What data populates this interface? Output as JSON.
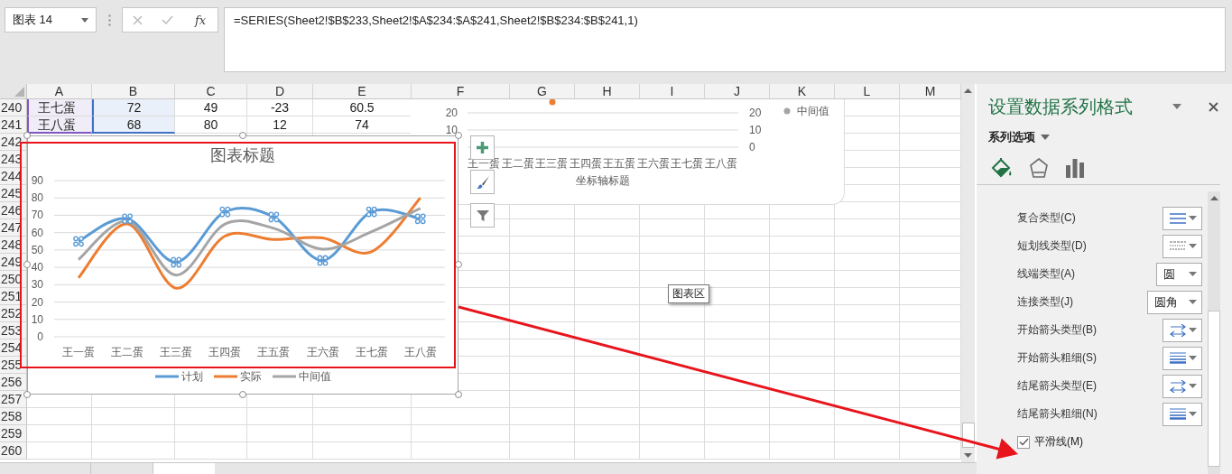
{
  "name_box": {
    "value": "图表 14"
  },
  "formula_bar": {
    "function_label": "fx",
    "formula": "=SERIES(Sheet2!$B$233,Sheet2!$A$234:$A$241,Sheet2!$B$234:$B$241,1)"
  },
  "sheet": {
    "columns": [
      {
        "label": "A",
        "color": "#7e57c2"
      },
      {
        "label": "B",
        "color": "#3f72c6"
      },
      {
        "label": "C"
      },
      {
        "label": "D"
      },
      {
        "label": "E"
      },
      {
        "label": "F"
      },
      {
        "label": "G"
      },
      {
        "label": "H"
      },
      {
        "label": "I"
      },
      {
        "label": "J"
      },
      {
        "label": "K"
      },
      {
        "label": "L"
      },
      {
        "label": "M"
      }
    ],
    "rows": [
      {
        "number": "240",
        "cells": [
          "王七蛋",
          "72",
          "49",
          "-23",
          "60.5"
        ]
      },
      {
        "number": "241",
        "cells": [
          "王八蛋",
          "68",
          "80",
          "12",
          "74"
        ]
      },
      {
        "number": "242"
      },
      {
        "number": "243"
      },
      {
        "number": "244"
      },
      {
        "number": "245"
      },
      {
        "number": "246"
      },
      {
        "number": "247"
      },
      {
        "number": "248"
      },
      {
        "number": "249"
      },
      {
        "number": "250"
      },
      {
        "number": "251"
      },
      {
        "number": "252"
      },
      {
        "number": "253"
      },
      {
        "number": "254"
      },
      {
        "number": "255"
      },
      {
        "number": "256"
      },
      {
        "number": "257"
      },
      {
        "number": "258"
      },
      {
        "number": "259"
      },
      {
        "number": "260"
      }
    ]
  },
  "chart": {
    "chart_data": {
      "type": "line",
      "title": "图表标题",
      "categories": [
        "王一蛋",
        "王二蛋",
        "王三蛋",
        "王四蛋",
        "王五蛋",
        "王六蛋",
        "王七蛋",
        "王八蛋"
      ],
      "series": [
        {
          "name": "计划",
          "color": "#5b9bd5",
          "values": [
            55,
            68,
            43,
            72,
            69,
            44,
            72,
            68
          ],
          "marker": "cross"
        },
        {
          "name": "实际",
          "color": "#ed7d31",
          "values": [
            34,
            65,
            28,
            58,
            56,
            57,
            49,
            80
          ]
        },
        {
          "name": "中间值",
          "color": "#a5a5a5",
          "values": [
            44.5,
            66.5,
            35.5,
            65,
            62.5,
            50.5,
            60.5,
            74
          ]
        }
      ],
      "ylim": [
        0,
        90
      ],
      "yticks": [
        0,
        10,
        20,
        30,
        40,
        50,
        60,
        70,
        80,
        90
      ],
      "grid": true,
      "legend": "bottom"
    }
  },
  "back_chart": {
    "left_ticks": [
      "20",
      "10"
    ],
    "right_ticks": [
      "20",
      "10",
      "0"
    ],
    "legend": "中间值",
    "categories": [
      "王一蛋",
      "王二蛋",
      "王三蛋",
      "王四蛋",
      "王五蛋",
      "王六蛋",
      "王七蛋",
      "王八蛋"
    ],
    "axis_title": "坐标轴标题"
  },
  "tooltip": "图表区",
  "pane": {
    "title": "设置数据系列格式",
    "section": "系列选项",
    "tabs": [
      {
        "kind": "fill",
        "selected": true
      },
      {
        "kind": "effects",
        "selected": false
      },
      {
        "kind": "series",
        "selected": false
      }
    ],
    "rows": [
      {
        "label": "复合类型(C)",
        "kind": "lines"
      },
      {
        "label": "短划线类型(D)",
        "kind": "dashes"
      },
      {
        "label": "线端类型(A)",
        "kind": "text",
        "value": "圆"
      },
      {
        "label": "连接类型(J)",
        "kind": "text",
        "value": "圆角"
      },
      {
        "label": "开始箭头类型(B)",
        "kind": "arrows"
      },
      {
        "label": "开始箭头粗细(S)",
        "kind": "weights"
      },
      {
        "label": "结尾箭头类型(E)",
        "kind": "arrows"
      },
      {
        "label": "结尾箭头粗细(N)",
        "kind": "weights"
      }
    ],
    "smooth": {
      "label": "平滑线(M)",
      "checked": true
    }
  }
}
